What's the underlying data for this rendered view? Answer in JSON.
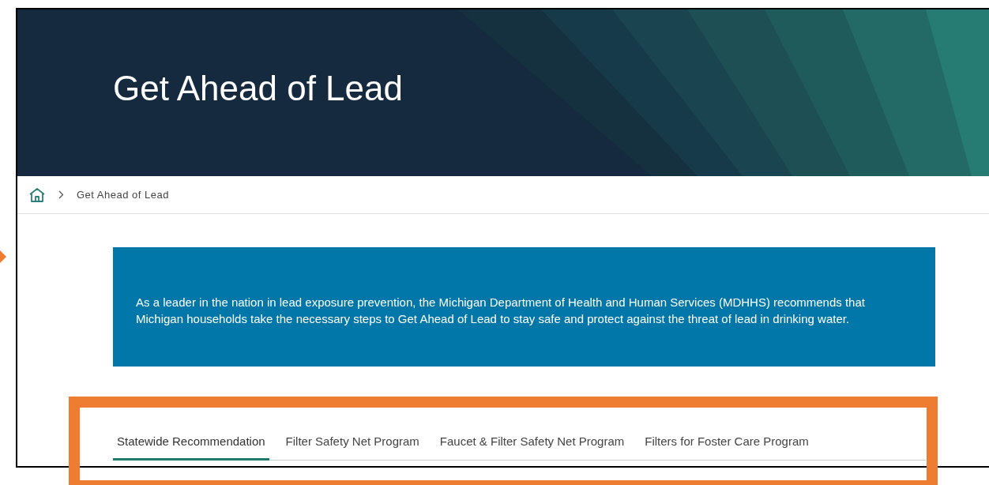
{
  "hero": {
    "title": "Get Ahead of Lead"
  },
  "breadcrumb": {
    "current": "Get Ahead of Lead"
  },
  "intro": {
    "text": "As a leader in the nation in lead exposure prevention, the Michigan Department of Health and Human Services (MDHHS) recommends that Michigan households take the necessary steps to Get Ahead of Lead to stay safe and protect against the threat of lead in drinking water."
  },
  "tabs": [
    {
      "label": "Statewide Recommendation",
      "selected": true
    },
    {
      "label": "Filter Safety Net Program",
      "selected": false
    },
    {
      "label": "Faucet & Filter Safety Net Program",
      "selected": false
    },
    {
      "label": "Filters for Foster Care Program",
      "selected": false
    }
  ]
}
